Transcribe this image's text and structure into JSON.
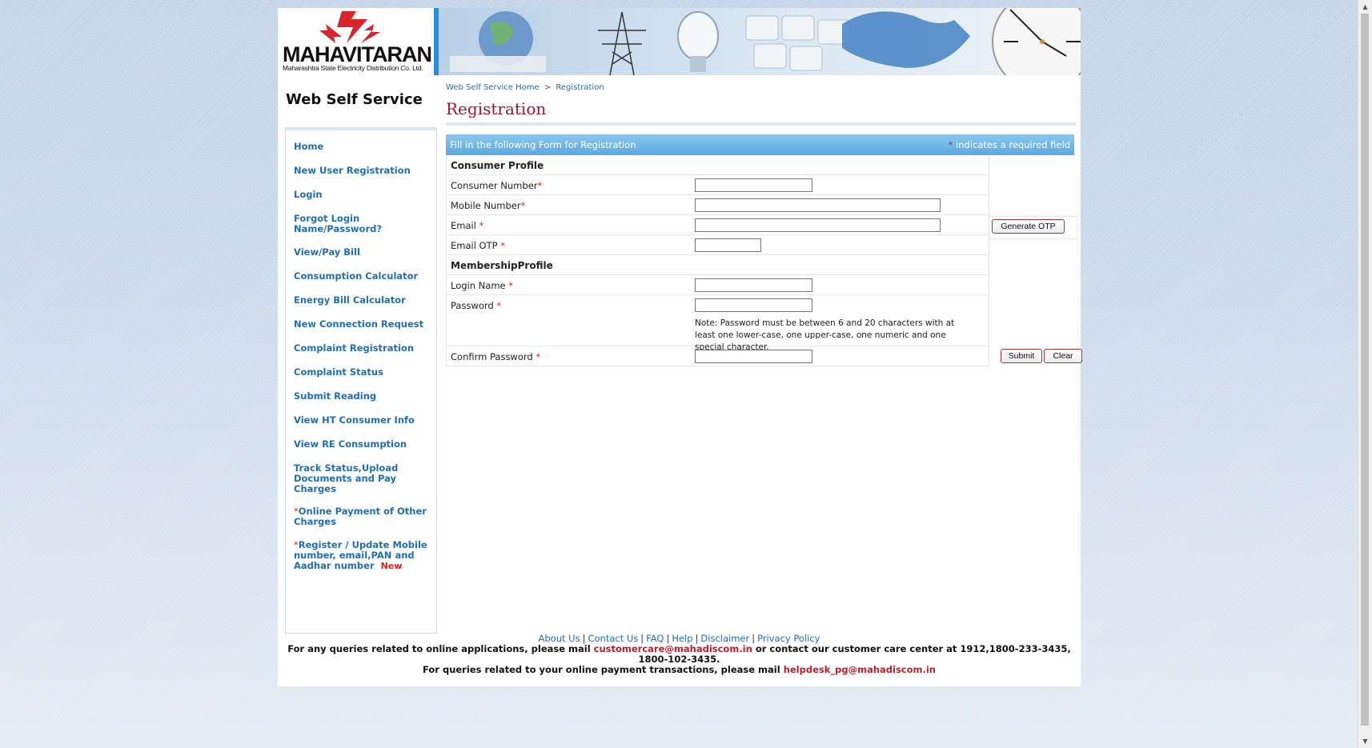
{
  "brand": {
    "logo_text": "MAHAVITARAN",
    "logo_sub": "Maharashtra State Electricity Distribution Co. Ltd."
  },
  "header": {
    "site_title": "Web Self Service",
    "breadcrumb": [
      "Web Self Service Home",
      ">",
      "Registration"
    ],
    "page_title": "Registration"
  },
  "sidebar": {
    "items": [
      {
        "label": "Home"
      },
      {
        "label": "New User Registration"
      },
      {
        "label": "Login"
      },
      {
        "label": "Forgot Login Name/Password?"
      },
      {
        "label": "View/Pay Bill"
      },
      {
        "label": "Consumption Calculator"
      },
      {
        "label": "Energy Bill Calculator"
      },
      {
        "label": "New Connection Request"
      },
      {
        "label": "Complaint Registration"
      },
      {
        "label": "Complaint Status"
      },
      {
        "label": "Submit Reading"
      },
      {
        "label": "View HT Consumer Info"
      },
      {
        "label": "View RE Consumption"
      },
      {
        "label": "Track Status,Upload Documents and Pay Charges"
      },
      {
        "label": "Online Payment of Other Charges",
        "star": "*"
      },
      {
        "label": "Register / Update Mobile number, email,PAN and Aadhar number",
        "star": "*",
        "badge": "New"
      }
    ]
  },
  "form": {
    "header_left": "Fill in the following Form for Registration",
    "required_mark": "*",
    "header_right": " indicates a required field",
    "consumer_section": "Consumer Profile",
    "membership_section": "MembershipProfile",
    "fields": {
      "consumer_number": {
        "label": "Consumer Number",
        "req": "*",
        "value": ""
      },
      "mobile_number": {
        "label": "Mobile Number",
        "req": "*",
        "value": ""
      },
      "email": {
        "label": "Email ",
        "req": "*",
        "value": ""
      },
      "email_otp": {
        "label": "Email OTP ",
        "req": "*",
        "value": ""
      },
      "login_name": {
        "label": "Login Name ",
        "req": "*",
        "value": ""
      },
      "password": {
        "label": "Password ",
        "req": "*",
        "value": ""
      },
      "confirm_password": {
        "label": "Confirm Password ",
        "req": "*",
        "value": ""
      }
    },
    "password_note": "Note: Password must be between 6 and 20 characters with at least one lower-case, one upper-case, one numeric and one special character.",
    "generate_otp_label": "Generate OTP",
    "submit_label": "Submit",
    "clear_label": "Clear"
  },
  "footer": {
    "links": [
      "About Us",
      "Contact Us",
      "FAQ",
      "Help",
      "Disclaimer",
      "Privacy Policy"
    ],
    "sep": "|",
    "line1_pre": "For any queries related to online applications, please mail ",
    "line1_mail": "customercare@mahadiscom.in",
    "line1_post": " or contact our customer care center at 1912,1800-233-3435, 1800-102-3435.",
    "line2_pre": "For queries related to your online payment transactions, please mail ",
    "line2_mail": "helpdesk_pg@mahadiscom.in"
  },
  "colors": {
    "brand_red": "#a0182c",
    "link_blue": "#1f6fb5",
    "form_header_blue": "#6db4e6",
    "required_red": "#d22222"
  }
}
